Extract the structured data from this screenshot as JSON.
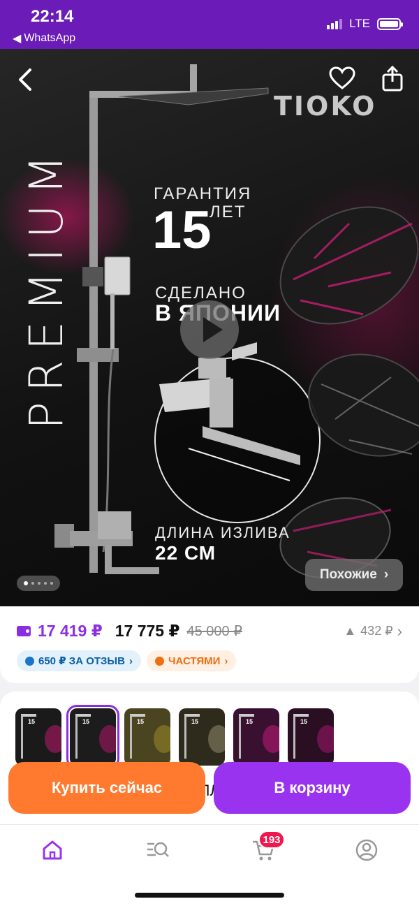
{
  "status_bar": {
    "time": "22:14",
    "back_app": "WhatsApp",
    "network": "LTE"
  },
  "hero": {
    "vertical_text": "PREMIUM",
    "brand": "TIOKO",
    "warranty_label": "ГАРАНТИЯ",
    "warranty_number": "15",
    "warranty_unit": "ЛЕТ",
    "made_line1": "СДЕЛАНО",
    "made_line2": "В ЯПОНИИ",
    "spout_label": "ДЛИНА ИЗЛИВА",
    "spout_value": "22 СМ",
    "similar_label": "Похожие",
    "slides_count": 5,
    "active_slide": 1
  },
  "price": {
    "wallet_price": "17 419 ₽",
    "price": "17 775 ₽",
    "old_price": "45 000 ₽",
    "tail": "432 ₽"
  },
  "chips": {
    "review": "650 ₽ ЗА ОТЗЫВ",
    "installments": "ЧАСТЯМИ"
  },
  "variants": {
    "items": [
      {
        "number": "15",
        "bg": "#1a1a1a",
        "accent": "#c0186e"
      },
      {
        "number": "15",
        "bg": "#1c1c1c",
        "accent": "#b3166a"
      },
      {
        "number": "15",
        "bg": "#4a4420",
        "accent": "#9c8a2a"
      },
      {
        "number": "15",
        "bg": "#2e2b1c",
        "accent": "#8f8a70"
      },
      {
        "number": "15",
        "bg": "#3a1030",
        "accent": "#c01a7a"
      },
      {
        "number": "15",
        "bg": "#2a0e22",
        "accent": "#a3186e"
      }
    ],
    "selected_index": 1,
    "hidden_text_fragment": "ЛЛ"
  },
  "actions": {
    "buy_now": "Купить сейчас",
    "add_to_cart": "В корзину"
  },
  "tabbar": {
    "cart_badge": "193"
  },
  "colors": {
    "brand_purple": "#6a1bb8",
    "accent_purple": "#9a33f0",
    "buy_orange": "#ff7a2f",
    "badge_red": "#f0174f"
  }
}
